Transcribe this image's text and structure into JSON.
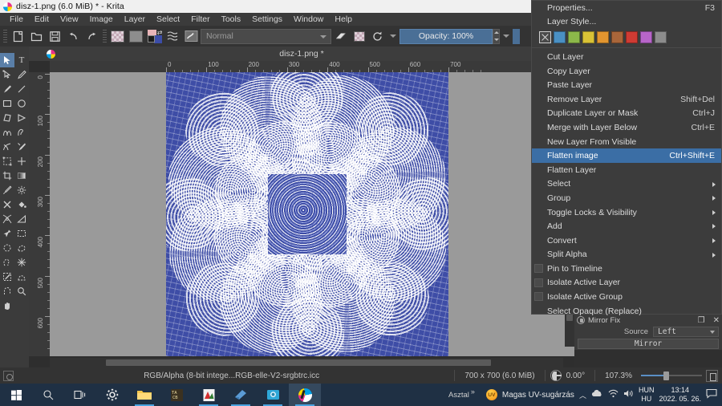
{
  "window": {
    "title": "disz-1.png (6.0 MiB) * - Krita",
    "app_icon": "krita-logo-icon"
  },
  "menubar": {
    "items": [
      {
        "label": "File"
      },
      {
        "label": "Edit"
      },
      {
        "label": "View"
      },
      {
        "label": "Image"
      },
      {
        "label": "Layer",
        "active": true
      },
      {
        "label": "Select"
      },
      {
        "label": "Filter"
      },
      {
        "label": "Tools"
      },
      {
        "label": "Settings"
      },
      {
        "label": "Window"
      },
      {
        "label": "Help"
      }
    ]
  },
  "toolbar": {
    "blend_mode": "Normal",
    "opacity_label": "Opacity: 100%",
    "icons": [
      "new-document-icon",
      "open-file-icon",
      "save-icon",
      "undo-icon",
      "redo-icon",
      "transparency-checker-icon",
      "gray-swatch-icon",
      "foreground-background-color-icon",
      "gradient-list-icon",
      "brush-preset-icon",
      "eraser-icon",
      "alpha-lock-icon",
      "reload-preset-icon"
    ]
  },
  "toolbox": {
    "tools": [
      {
        "name": "select-shapes-tool",
        "glyph": "arrow",
        "selected": true
      },
      {
        "name": "text-tool",
        "glyph": "T"
      },
      {
        "name": "edit-shapes-tool",
        "glyph": "node-arrow"
      },
      {
        "name": "calligraphy-tool",
        "glyph": "pen"
      },
      {
        "name": "freehand-brush-tool",
        "glyph": "brush"
      },
      {
        "name": "line-tool",
        "glyph": "line"
      },
      {
        "name": "rectangle-tool",
        "glyph": "rect"
      },
      {
        "name": "ellipse-tool",
        "glyph": "ellipse"
      },
      {
        "name": "polygon-tool",
        "glyph": "polygon"
      },
      {
        "name": "polyline-tool",
        "glyph": "polyline"
      },
      {
        "name": "bezier-curve-tool",
        "glyph": "bezier"
      },
      {
        "name": "freehand-path-tool",
        "glyph": "freehand-path"
      },
      {
        "name": "dynamic-brush-tool",
        "glyph": "dynbrush"
      },
      {
        "name": "multibrush-tool",
        "glyph": "multibrush"
      },
      {
        "name": "transform-tool",
        "glyph": "transform"
      },
      {
        "name": "move-tool",
        "glyph": "move"
      },
      {
        "name": "crop-tool",
        "glyph": "crop"
      },
      {
        "name": "gradient-tool",
        "glyph": "gradient"
      },
      {
        "name": "color-sampler-tool",
        "glyph": "eyedropper"
      },
      {
        "name": "colorize-mask-tool",
        "glyph": "colorize"
      },
      {
        "name": "smart-patch-tool",
        "glyph": "patch"
      },
      {
        "name": "fill-tool",
        "glyph": "bucket"
      },
      {
        "name": "assistant-tool",
        "glyph": "assistant"
      },
      {
        "name": "measure-tool",
        "glyph": "measure"
      },
      {
        "name": "reference-images-tool",
        "glyph": "pin"
      },
      {
        "name": "rectangular-selection-tool",
        "glyph": "sel-rect"
      },
      {
        "name": "elliptical-selection-tool",
        "glyph": "sel-ellipse"
      },
      {
        "name": "polygonal-selection-tool",
        "glyph": "sel-poly"
      },
      {
        "name": "freehand-selection-tool",
        "glyph": "sel-free"
      },
      {
        "name": "contiguous-selection-tool",
        "glyph": "sel-contig"
      },
      {
        "name": "similar-color-selection-tool",
        "glyph": "sel-similar"
      },
      {
        "name": "bezier-selection-tool",
        "glyph": "sel-bezier"
      },
      {
        "name": "magnetic-selection-tool",
        "glyph": "sel-magnetic"
      },
      {
        "name": "zoom-tool",
        "glyph": "zoom"
      },
      {
        "name": "pan-tool",
        "glyph": "hand"
      }
    ]
  },
  "document": {
    "tab_title": "disz-1.png *",
    "h_ruler_labels": [
      "0",
      "100",
      "200",
      "300",
      "400",
      "500",
      "600",
      "700"
    ],
    "v_ruler_labels": [
      "0",
      "100",
      "200",
      "300",
      "400",
      "500",
      "600"
    ],
    "canvas_color": "#3e4da6",
    "artwork_name": "blue-white-moire-mandala"
  },
  "context_menu": {
    "title": "layer-menu",
    "items": [
      {
        "label": "Properties...",
        "accel": "F3",
        "type": "item"
      },
      {
        "label": "Layer Style...",
        "accel": "",
        "type": "item"
      },
      {
        "type": "swatches"
      },
      {
        "label": "Cut Layer",
        "accel": "",
        "type": "item"
      },
      {
        "label": "Copy Layer",
        "accel": "",
        "type": "item"
      },
      {
        "label": "Paste Layer",
        "accel": "",
        "type": "item"
      },
      {
        "label": "Remove Layer",
        "accel": "Shift+Del",
        "type": "item"
      },
      {
        "label": "Duplicate Layer or Mask",
        "accel": "Ctrl+J",
        "type": "item"
      },
      {
        "label": "Merge with Layer Below",
        "accel": "Ctrl+E",
        "type": "item"
      },
      {
        "label": "New Layer From Visible",
        "accel": "",
        "type": "item"
      },
      {
        "label": "Flatten image",
        "accel": "Ctrl+Shift+E",
        "type": "item",
        "highlighted": true
      },
      {
        "label": "Flatten Layer",
        "accel": "",
        "type": "item"
      },
      {
        "label": "Select",
        "accel": "",
        "type": "submenu"
      },
      {
        "label": "Group",
        "accel": "",
        "type": "submenu"
      },
      {
        "label": "Toggle Locks & Visibility",
        "accel": "",
        "type": "submenu"
      },
      {
        "label": "Add",
        "accel": "",
        "type": "submenu"
      },
      {
        "label": "Convert",
        "accel": "",
        "type": "submenu"
      },
      {
        "label": "Split Alpha",
        "accel": "",
        "type": "submenu"
      },
      {
        "label": "Pin to Timeline",
        "accel": "",
        "type": "checkitem"
      },
      {
        "label": "Isolate Active Layer",
        "accel": "",
        "type": "checkitem"
      },
      {
        "label": "Isolate Active Group",
        "accel": "",
        "type": "checkitem"
      },
      {
        "label": "Select Opaque (Replace)",
        "accel": "",
        "type": "item"
      }
    ],
    "swatch_colors": [
      "none",
      "#4a90c4",
      "#8cb84a",
      "#d9c236",
      "#e2952f",
      "#a9663a",
      "#cf3b33",
      "#b765c9",
      "#8c8c8c"
    ]
  },
  "mirror_fix": {
    "title": "Mirror Fix",
    "source_label": "Source",
    "source_value": "Left",
    "button_label": "Mirror"
  },
  "statusbar": {
    "colorspace": "RGB/Alpha (8-bit intege...RGB-elle-V2-srgbtrc.icc",
    "dimensions": "700 x 700 (6.0 MiB)",
    "rotation": "0.00°",
    "zoom": "107.3%"
  },
  "taskbar": {
    "apps": [
      {
        "name": "start-button-icon"
      },
      {
        "name": "search-icon"
      },
      {
        "name": "task-view-icon"
      },
      {
        "name": "settings-gear-icon"
      },
      {
        "name": "file-explorer-icon"
      },
      {
        "name": "text-editor-icon"
      },
      {
        "name": "pdf-reader-icon"
      },
      {
        "name": "sticky-notes-icon"
      },
      {
        "name": "camera-app-icon"
      },
      {
        "name": "krita-taskbar-icon"
      }
    ],
    "desktop_label": "Asztal",
    "weather_text": "Magas UV-sugárzás",
    "keyboard_lang_top": "HUN",
    "keyboard_lang_bottom": "HU",
    "time": "13:14",
    "date": "2022. 05. 26."
  }
}
